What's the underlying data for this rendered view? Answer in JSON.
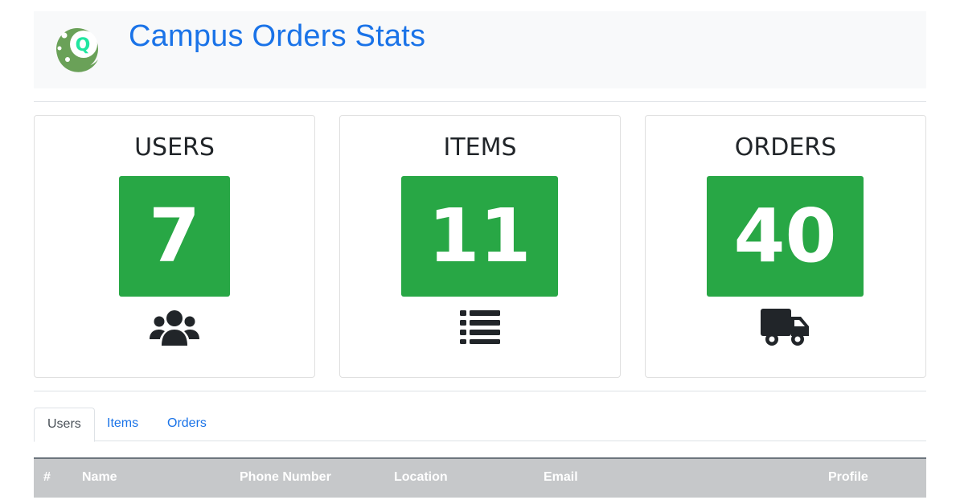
{
  "header": {
    "title": "Campus Orders Stats",
    "logo_letter": "Q",
    "logo_color": "#6aa158",
    "logo_accent": "#21e6a0"
  },
  "stats": [
    {
      "label": "USERS",
      "value": "7",
      "icon": "users-icon"
    },
    {
      "label": "ITEMS",
      "value": "11",
      "icon": "list-icon"
    },
    {
      "label": "ORDERS",
      "value": "40",
      "icon": "truck-icon"
    }
  ],
  "colors": {
    "accent": "#1a73e8",
    "stat_green": "#28a745",
    "table_header": "#c6c8ca"
  },
  "tabs": [
    {
      "label": "Users",
      "active": true
    },
    {
      "label": "Items",
      "active": false
    },
    {
      "label": "Orders",
      "active": false
    }
  ],
  "table": {
    "columns": [
      "#",
      "Name",
      "Phone Number",
      "Location",
      "Email",
      "Profile"
    ]
  }
}
